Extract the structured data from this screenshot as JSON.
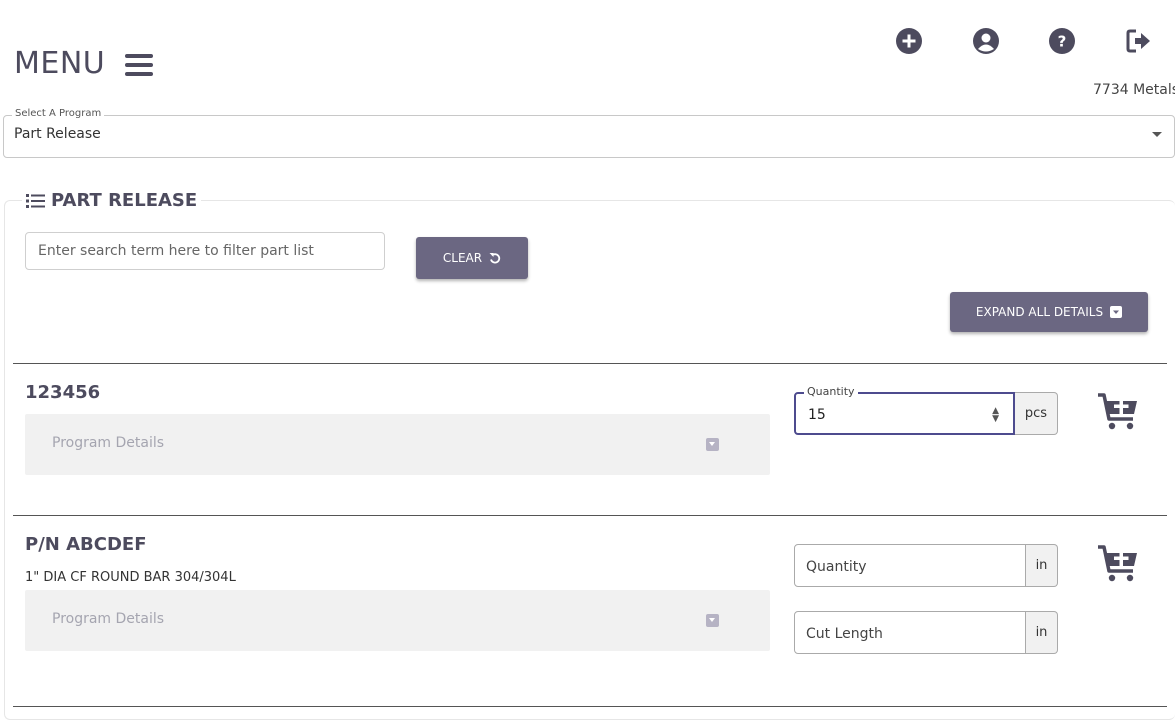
{
  "header": {
    "menu_label": "MENU",
    "org_name": "7734 Metals",
    "icons": [
      "plus-circle-icon",
      "user-circle-icon",
      "question-circle-icon",
      "sign-out-icon"
    ]
  },
  "program_select": {
    "label": "Select A Program",
    "value": "Part Release"
  },
  "part_release": {
    "title": "PART RELEASE",
    "search_placeholder": "Enter search term here to filter part list",
    "clear_label": "CLEAR",
    "expand_label": "EXPAND ALL DETAILS"
  },
  "parts": [
    {
      "title": "123456",
      "description": "",
      "details_label": "Program Details",
      "quantity_label": "Quantity",
      "quantity_value": "15",
      "quantity_unit": "pcs"
    },
    {
      "title": "P/N ABCDEF",
      "description": "1\" DIA CF ROUND BAR 304/304L",
      "details_label": "Program Details",
      "quantity_placeholder": "Quantity",
      "quantity_unit": "in",
      "cut_length_placeholder": "Cut Length",
      "cut_length_unit": "in"
    }
  ],
  "colors": {
    "primary": "#6b6782",
    "text_dark": "#4d4b5e",
    "details_bg": "#f1f1f1"
  }
}
